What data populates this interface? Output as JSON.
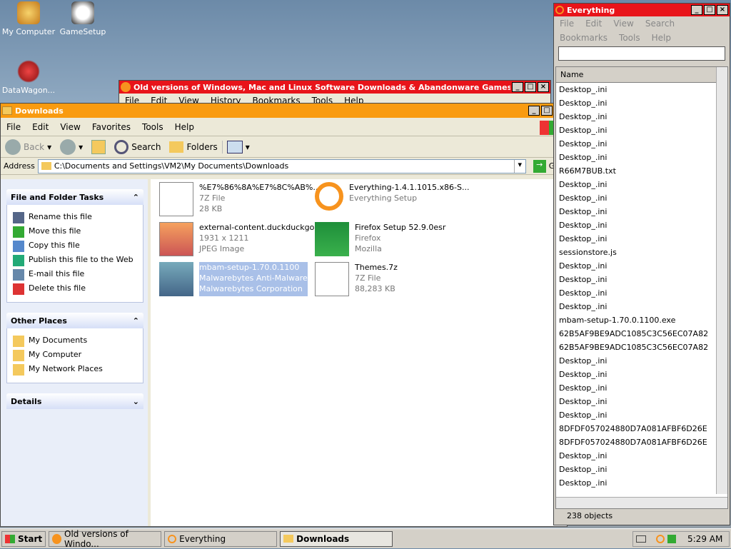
{
  "desktop": {
    "icons": [
      {
        "label": "My Computer"
      },
      {
        "label": "GameSetup"
      },
      {
        "label": "DataWagon..."
      }
    ]
  },
  "oldver": {
    "title": "Old versions of Windows, Mac and Linux Software Downloads & Abandonware Games - OldVer",
    "menu": [
      "File",
      "Edit",
      "View",
      "History",
      "Bookmarks",
      "Tools",
      "Help"
    ]
  },
  "explorer": {
    "title": "Downloads",
    "menu": [
      "File",
      "Edit",
      "View",
      "Favorites",
      "Tools",
      "Help"
    ],
    "toolbar": {
      "back": "Back",
      "search": "Search",
      "folders": "Folders"
    },
    "address_label": "Address",
    "address": "C:\\Documents and Settings\\VM2\\My Documents\\Downloads",
    "go": "Go",
    "tasks_title": "File and Folder Tasks",
    "tasks": [
      "Rename this file",
      "Move this file",
      "Copy this file",
      "Publish this file to the Web",
      "E-mail this file",
      "Delete this file"
    ],
    "places_title": "Other Places",
    "places": [
      "My Documents",
      "My Computer",
      "My Network Places"
    ],
    "details_title": "Details",
    "files": [
      {
        "name": "%E7%86%8A%E7%8C%AB%...",
        "l2": "7Z File",
        "l3": "28 KB"
      },
      {
        "name": "Everything-1.4.1.1015.x86-S...",
        "l2": "Everything Setup",
        "l3": ""
      },
      {
        "name": "external-content.duckduckgo...",
        "l2": "1931 x 1211",
        "l3": "JPEG Image"
      },
      {
        "name": "Firefox Setup 52.9.0esr",
        "l2": "Firefox",
        "l3": "Mozilla"
      },
      {
        "name": "mbam-setup-1.70.0.1100",
        "l2": "Malwarebytes Anti-Malware",
        "l3": "Malwarebytes Corporation"
      },
      {
        "name": "Themes.7z",
        "l2": "7Z File",
        "l3": "88,283 KB"
      }
    ]
  },
  "everything": {
    "title": "Everything",
    "menu1": [
      "File",
      "Edit",
      "View",
      "Search"
    ],
    "menu2": [
      "Bookmarks",
      "Tools",
      "Help"
    ],
    "search_value": "",
    "column": "Name",
    "items": [
      "Desktop_.ini",
      "Desktop_.ini",
      "Desktop_.ini",
      "Desktop_.ini",
      "Desktop_.ini",
      "Desktop_.ini",
      "R66M7BUB.txt",
      "Desktop_.ini",
      "Desktop_.ini",
      "Desktop_.ini",
      "Desktop_.ini",
      "Desktop_.ini",
      "sessionstore.js",
      "Desktop_.ini",
      "Desktop_.ini",
      "Desktop_.ini",
      "Desktop_.ini",
      "mbam-setup-1.70.0.1100.exe",
      "62B5AF9BE9ADC1085C3C56EC07A82",
      "62B5AF9BE9ADC1085C3C56EC07A82",
      "Desktop_.ini",
      "Desktop_.ini",
      "Desktop_.ini",
      "Desktop_.ini",
      "Desktop_.ini",
      "8DFDF057024880D7A081AFBF6D26E",
      "8DFDF057024880D7A081AFBF6D26E",
      "Desktop_.ini",
      "Desktop_.ini",
      "Desktop_.ini"
    ],
    "status": "238 objects"
  },
  "taskbar": {
    "start": "Start",
    "tasks": [
      "Old versions of Windo...",
      "Everything",
      "Downloads"
    ],
    "time": "5:29 AM"
  }
}
